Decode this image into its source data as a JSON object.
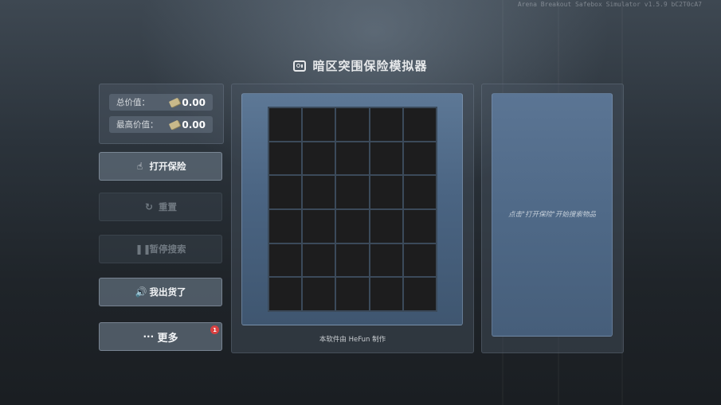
{
  "app": {
    "version": "Arena Breakout Safebox Simulator v1.5.9  bC2T0cA7",
    "title": "暗区突围保险模拟器"
  },
  "stats": {
    "total_label": "总价值：",
    "total_value": "0.00",
    "max_label": "最高价值：",
    "max_value": "0.00"
  },
  "buttons": {
    "open": "打开保险",
    "reset": "重置",
    "pause": "暂停搜索",
    "ship": "我出货了",
    "more": "更多",
    "more_badge": "1"
  },
  "icons": {
    "title": "safe-icon",
    "money": "money-icon",
    "open": "hand-pointer-icon",
    "reset": "refresh-icon",
    "pause": "pause-icon",
    "ship": "speaker-icon",
    "more": "ellipsis-icon"
  },
  "grid": {
    "columns": 5,
    "rows": 6
  },
  "footer": {
    "credit": "本软件由 HeFun 制作"
  },
  "hint": {
    "text": "点击\"打开保险\"开始搜索物品"
  },
  "colors": {
    "accent_blue": "#4e6886",
    "cell": "#1d1d1e",
    "badge": "#d94040"
  }
}
